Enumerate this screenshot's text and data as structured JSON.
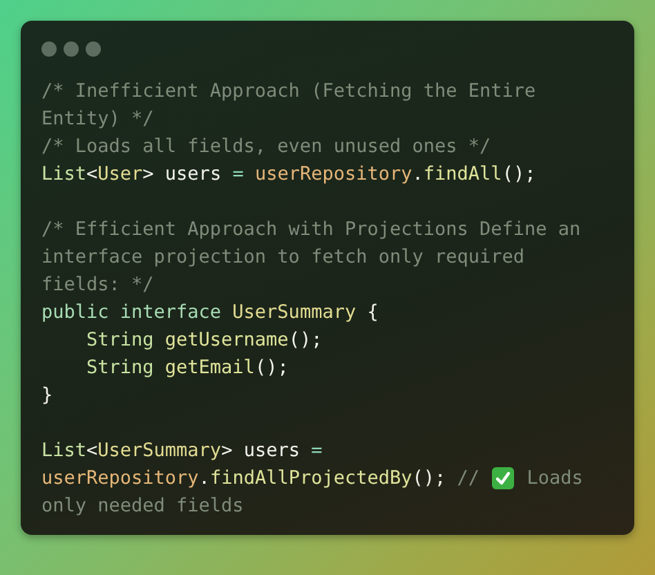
{
  "window": {
    "controls": [
      {
        "kind": "dot"
      },
      {
        "kind": "dot"
      },
      {
        "kind": "dot"
      }
    ]
  },
  "code": {
    "lines": [
      {
        "tokens": [
          {
            "text": "/* Inefficient Approach (Fetching the Entire",
            "kind": "comment"
          }
        ]
      },
      {
        "tokens": [
          {
            "text": "Entity) */",
            "kind": "comment"
          }
        ]
      },
      {
        "tokens": [
          {
            "text": "/* Loads all fields, even unused ones */",
            "kind": "comment"
          }
        ]
      },
      {
        "tokens": [
          {
            "text": "List",
            "kind": "type"
          },
          {
            "text": "<",
            "kind": "punct"
          },
          {
            "text": "User",
            "kind": "generic"
          },
          {
            "text": "> users ",
            "kind": "punct"
          },
          {
            "text": "= ",
            "kind": "op"
          },
          {
            "text": "userRepository",
            "kind": "object"
          },
          {
            "text": ".",
            "kind": "punct"
          },
          {
            "text": "findAll",
            "kind": "method"
          },
          {
            "text": "();",
            "kind": "punct"
          }
        ]
      },
      {
        "blank_before": true,
        "tokens": [
          {
            "text": "/* Efficient Approach with Projections Define an",
            "kind": "comment"
          }
        ]
      },
      {
        "tokens": [
          {
            "text": "interface projection to fetch only required",
            "kind": "comment"
          }
        ]
      },
      {
        "tokens": [
          {
            "text": "fields: */",
            "kind": "comment"
          }
        ]
      },
      {
        "tokens": [
          {
            "text": "public interface ",
            "kind": "keyword"
          },
          {
            "text": "UserSummary",
            "kind": "generic"
          },
          {
            "text": " {",
            "kind": "punct"
          }
        ]
      },
      {
        "tokens": [
          {
            "text": "    String ",
            "kind": "type"
          },
          {
            "text": "getUsername",
            "kind": "method"
          },
          {
            "text": "();",
            "kind": "punct"
          }
        ]
      },
      {
        "tokens": [
          {
            "text": "    String ",
            "kind": "type"
          },
          {
            "text": "getEmail",
            "kind": "method"
          },
          {
            "text": "();",
            "kind": "punct"
          }
        ]
      },
      {
        "tokens": [
          {
            "text": "}",
            "kind": "punct"
          }
        ]
      },
      {
        "blank_before": true,
        "tokens": [
          {
            "text": "List",
            "kind": "type"
          },
          {
            "text": "<",
            "kind": "punct"
          },
          {
            "text": "UserSummary",
            "kind": "generic"
          },
          {
            "text": "> users ",
            "kind": "punct"
          },
          {
            "text": "=",
            "kind": "op"
          }
        ]
      },
      {
        "tokens": [
          {
            "text": "userRepository",
            "kind": "object"
          },
          {
            "text": ".",
            "kind": "punct"
          },
          {
            "text": "findAllProjectedBy",
            "kind": "method"
          },
          {
            "text": "(); ",
            "kind": "punct"
          },
          {
            "text": "// ",
            "kind": "comment"
          },
          {
            "kind": "check-icon"
          },
          {
            "text": " Loads",
            "kind": "comment"
          }
        ]
      },
      {
        "tokens": [
          {
            "text": "only needed fields",
            "kind": "comment"
          }
        ]
      }
    ]
  }
}
